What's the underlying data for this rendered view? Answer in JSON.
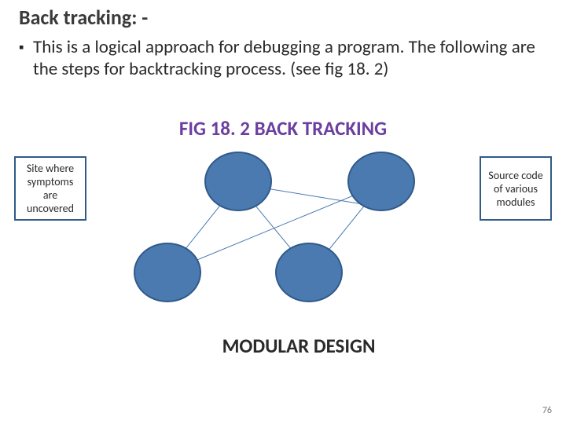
{
  "title": "Back tracking: -",
  "bullet": {
    "marker": "▪",
    "text": "This is a logical approach for debugging a program. The following are the steps for backtracking process. (see fig 18. 2)"
  },
  "figure": {
    "title": "FIG 18. 2 BACK TRACKING",
    "left_box": "Site where symptoms are uncovered",
    "right_box": "Source code of various modules",
    "footer": "MODULAR DESIGN"
  },
  "page_number": "76"
}
